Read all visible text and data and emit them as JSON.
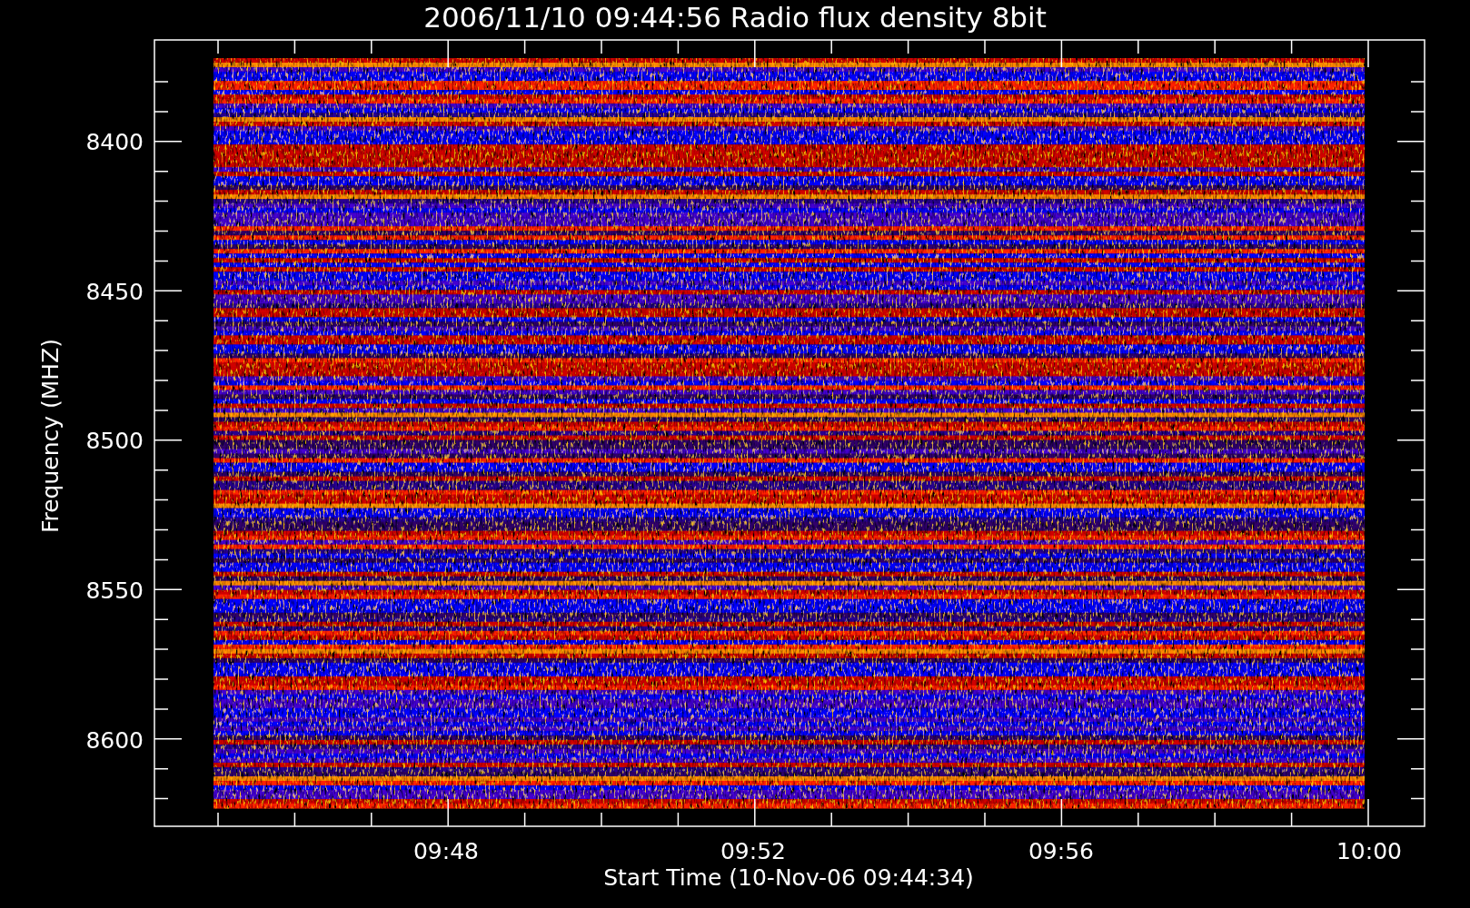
{
  "title": "2006/11/10 09:44:56 Radio flux density 8bit",
  "y_axis": {
    "label": "Frequency (MHZ)",
    "ticks": [
      "8400",
      "8450",
      "8500",
      "8550",
      "8600"
    ]
  },
  "x_axis": {
    "label": "Start Time (10-Nov-06 09:44:34)",
    "ticks": [
      "09:48",
      "09:52",
      "09:56",
      "10:00"
    ]
  }
}
